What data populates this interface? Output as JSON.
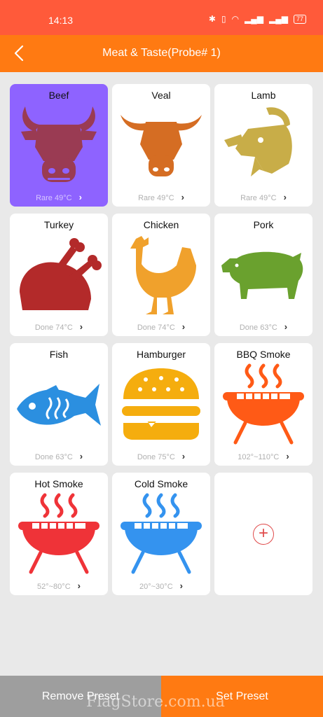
{
  "status": {
    "time": "14:13",
    "battery": "77"
  },
  "header": {
    "title": "Meat & Taste(Probe# 1)"
  },
  "items": [
    {
      "name": "Beef",
      "caption": "Rare 49°C",
      "color": "#9a3b53",
      "icon": "cow-icon"
    },
    {
      "name": "Veal",
      "caption": "Rare 49°C",
      "color": "#d56d23",
      "icon": "calf-icon"
    },
    {
      "name": "Lamb",
      "caption": "Rare 49°C",
      "color": "#c8ad48",
      "icon": "goat-icon"
    },
    {
      "name": "Turkey",
      "caption": "Done 74°C",
      "color": "#b32a2a",
      "icon": "roast-turkey-icon"
    },
    {
      "name": "Chicken",
      "caption": "Done 74°C",
      "color": "#f0a12c",
      "icon": "chicken-icon"
    },
    {
      "name": "Pork",
      "caption": "Done 63°C",
      "color": "#6aa12e",
      "icon": "pig-icon"
    },
    {
      "name": "Fish",
      "caption": "Done 63°C",
      "color": "#2b8fe0",
      "icon": "fish-icon"
    },
    {
      "name": "Hamburger",
      "caption": "Done 75°C",
      "color": "#f5ad0e",
      "icon": "hamburger-icon"
    },
    {
      "name": "BBQ Smoke",
      "caption": "102°~110°C",
      "color": "#ff5a16",
      "icon": "bbq-grill-icon"
    },
    {
      "name": "Hot Smoke",
      "caption": "52°~80°C",
      "color": "#ef3338",
      "icon": "hot-grill-icon"
    },
    {
      "name": "Cold Smoke",
      "caption": "20°~30°C",
      "color": "#3493ef",
      "icon": "cold-grill-icon"
    }
  ],
  "actions": {
    "remove_label": "Remove Preset",
    "set_label": "Set Preset"
  },
  "watermark": "FlagStore.com.ua",
  "colors": {
    "status_bar": "#ff5a3a",
    "app_bar": "#ff7a12",
    "selected_card": "#8e63ff",
    "remove_button": "#9e9e9e"
  }
}
